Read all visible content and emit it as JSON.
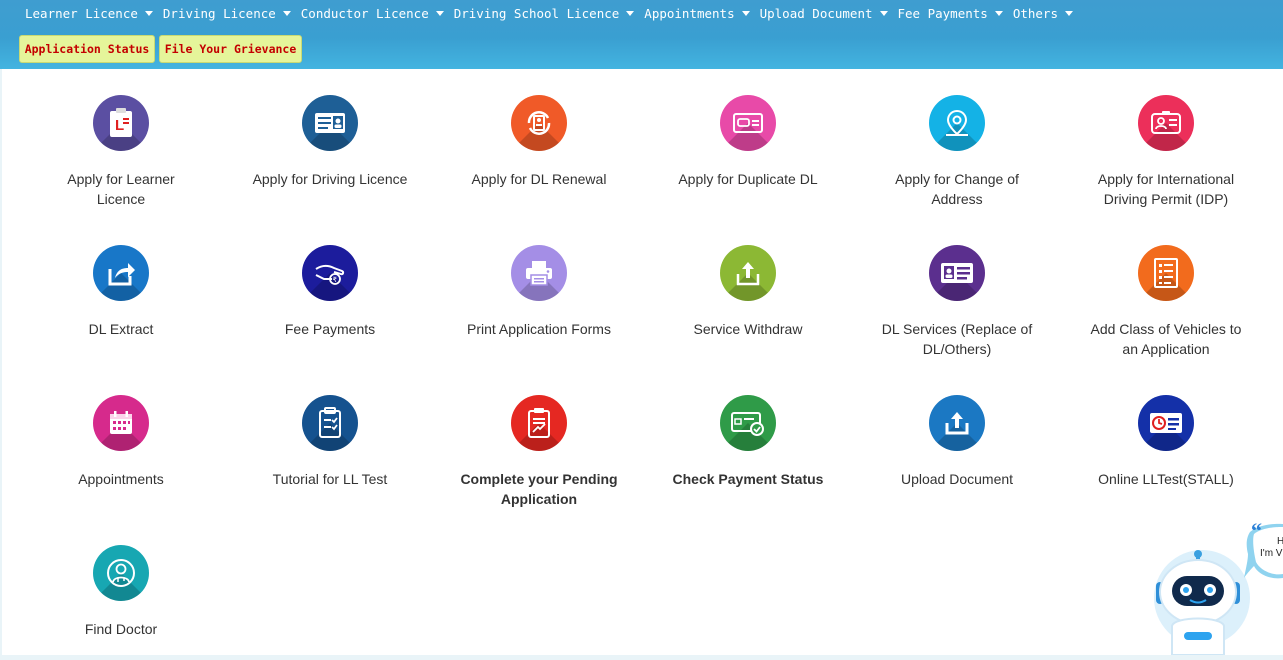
{
  "nav": {
    "items": [
      {
        "label": "Learner Licence"
      },
      {
        "label": "Driving Licence"
      },
      {
        "label": "Conductor Licence"
      },
      {
        "label": "Driving School Licence"
      },
      {
        "label": "Appointments"
      },
      {
        "label": "Upload Document"
      },
      {
        "label": "Fee Payments"
      },
      {
        "label": "Others"
      }
    ],
    "quick_links": [
      {
        "label": "Application Status"
      },
      {
        "label": "File Your Grievance"
      }
    ]
  },
  "services": [
    {
      "line1": "Apply for Learner",
      "line2": "Licence",
      "icon": "learner-licence-icon",
      "color": "#5b4fa2"
    },
    {
      "line1": "Apply for Driving Licence",
      "line2": "",
      "icon": "id-card-icon",
      "color": "#1e5f96"
    },
    {
      "line1": "Apply for DL Renewal",
      "line2": "",
      "icon": "renewal-icon",
      "color": "#f05a28"
    },
    {
      "line1": "Apply for Duplicate DL",
      "line2": "",
      "icon": "duplicate-card-icon",
      "color": "#e84aa8"
    },
    {
      "line1": "Apply for Change of",
      "line2": "Address",
      "icon": "map-pin-icon",
      "color": "#14b2e6"
    },
    {
      "line1": "Apply for International",
      "line2": "Driving Permit (IDP)",
      "icon": "permit-icon",
      "color": "#ec2f5a"
    },
    {
      "line1": "DL Extract",
      "line2": "",
      "icon": "share-icon",
      "color": "#1877c8"
    },
    {
      "line1": "Fee Payments",
      "line2": "",
      "icon": "payment-hand-icon",
      "color": "#1c1c9c"
    },
    {
      "line1": "Print Application Forms",
      "line2": "",
      "icon": "printer-icon",
      "color": "#a48ee6"
    },
    {
      "line1": "Service Withdraw",
      "line2": "",
      "icon": "withdraw-icon",
      "color": "#8cb834"
    },
    {
      "line1": "DL Services (Replace of",
      "line2": "DL/Others)",
      "icon": "profile-card-icon",
      "color": "#5b2f8e"
    },
    {
      "line1": "Add Class of Vehicles to",
      "line2": "an Application",
      "icon": "checklist-icon",
      "color": "#f26b1d"
    },
    {
      "line1": "Appointments",
      "line2": "",
      "icon": "calendar-icon",
      "color": "#d62a8c"
    },
    {
      "line1": "Tutorial for LL Test",
      "line2": "",
      "icon": "clipboard-icon",
      "color": "#15528f"
    },
    {
      "line1": "Complete your Pending",
      "line2": "Application",
      "icon": "pending-form-icon",
      "color": "#e52822",
      "bold": true
    },
    {
      "line1": "Check Payment Status",
      "line2": "",
      "icon": "card-check-icon",
      "color": "#2f9b48",
      "bold": true
    },
    {
      "line1": "Upload Document",
      "line2": "",
      "icon": "upload-icon",
      "color": "#1b78c3"
    },
    {
      "line1": "Online LLTest(STALL)",
      "line2": "",
      "icon": "online-test-icon",
      "color": "#1430a8"
    },
    {
      "line1": "Find Doctor",
      "line2": "",
      "icon": "doctor-icon",
      "color": "#17a7b2"
    }
  ],
  "chatbot": {
    "bubble_line1": "H",
    "bubble_line2": "I'm V"
  }
}
